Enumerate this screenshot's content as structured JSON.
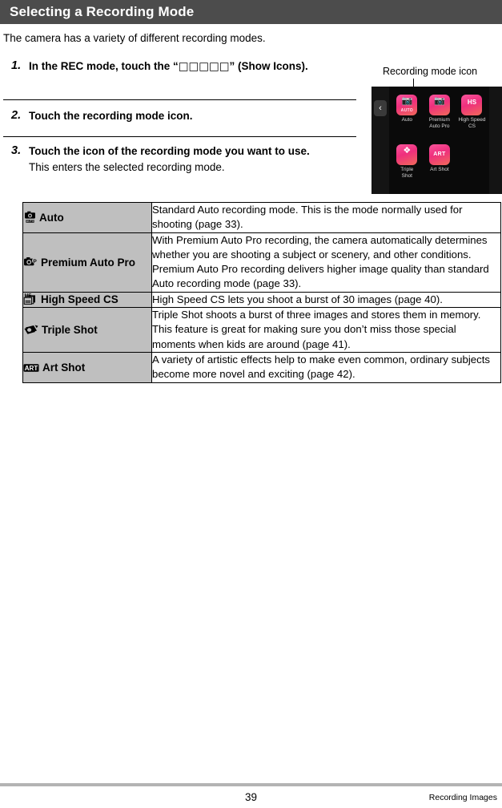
{
  "header": {
    "title": "Selecting a Recording Mode"
  },
  "intro": "The camera has a variety of different recording modes.",
  "steps": [
    {
      "number": "1.",
      "title_before": "In the REC mode, touch the “",
      "title_glyphs": "□□□□□",
      "title_after": "” (Show Icons).",
      "sub": ""
    },
    {
      "number": "2.",
      "title_before": "Touch the recording mode icon.",
      "title_glyphs": "",
      "title_after": "",
      "sub": ""
    },
    {
      "number": "3.",
      "title_before": "Touch the icon of the recording mode you want to use.",
      "title_glyphs": "",
      "title_after": "",
      "sub": "This enters the selected recording mode."
    }
  ],
  "callout": {
    "label": "Recording mode icon"
  },
  "camera_screen": {
    "back_button": "‹",
    "tiles": [
      {
        "label": "Auto",
        "icon": "camera-auto-icon",
        "sub": "AUTO"
      },
      {
        "label": "Premium\nAuto Pro",
        "icon": "camera-pro-icon",
        "sub": ""
      },
      {
        "label": "High Speed\nCS",
        "icon": "high-speed-cs-icon",
        "sub": "HS"
      },
      {
        "label": "Triple\nShot",
        "icon": "triple-shot-icon",
        "sub": ""
      },
      {
        "label": "Art Shot",
        "icon": "art-shot-icon",
        "sub": "ART"
      }
    ],
    "accent_color": "#ef2f7d",
    "background_color": "#0a0a0a"
  },
  "table": {
    "header_fill": "#bfbfbf",
    "rows": [
      {
        "icon": "camera-auto-icon",
        "name": "Auto",
        "desc": "Standard Auto recording mode. This is the mode normally used for shooting (page 33)."
      },
      {
        "icon": "camera-pro-icon",
        "name": "Premium Auto Pro",
        "desc": "With Premium Auto Pro recording, the camera automatically determines whether you are shooting a subject or scenery, and other conditions. Premium Auto Pro recording delivers higher image quality than standard Auto recording mode (page 33)."
      },
      {
        "icon": "high-speed-cs-icon",
        "name": "High Speed CS",
        "desc": "High Speed CS lets you shoot a burst of 30 images (page 40)."
      },
      {
        "icon": "triple-shot-icon",
        "name": "Triple Shot",
        "desc": "Triple Shot shoots a burst of three images and stores them in memory. This feature is great for making sure you don’t miss those special moments when kids are around (page 41)."
      },
      {
        "icon": "art-shot-icon",
        "name": "Art Shot",
        "desc": "A variety of artistic effects help to make even common, ordinary subjects become more novel and exciting (page 42)."
      }
    ]
  },
  "footer": {
    "page_number": "39",
    "section": "Recording Images"
  }
}
